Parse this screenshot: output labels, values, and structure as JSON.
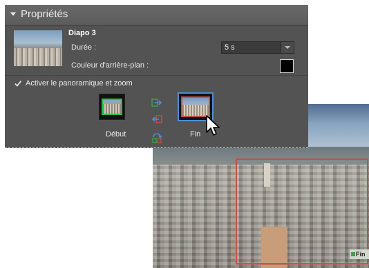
{
  "panel": {
    "title": "Propriétés",
    "slide_name": "Diapo 3",
    "duration_label": "Durée :",
    "duration_value": "5 s",
    "background_color_label": "Couleur d'arrière-plan :",
    "background_color": "#000000",
    "pan_zoom_checkbox_label": "Activer le panoramique et zoom",
    "pan_zoom_checked": true,
    "start_label": "Début",
    "end_label": "Fin"
  },
  "preview": {
    "frame_label": "Fin"
  },
  "colors": {
    "panel_bg": "#535353",
    "start_frame": "#2dbb3e",
    "end_frame": "#c0504d",
    "selection": "#4a90d9"
  },
  "icons": [
    "collapse-triangle-icon",
    "copy-start-to-end-icon",
    "copy-end-to-start-icon",
    "swap-frames-icon",
    "pointer-cursor-icon"
  ]
}
